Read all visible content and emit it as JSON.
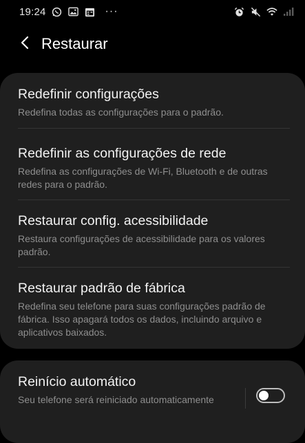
{
  "status_bar": {
    "time": "19:24",
    "left_icons": [
      "whatsapp-icon",
      "gallery-icon",
      "calendar-icon"
    ],
    "more": "···",
    "right_icons": [
      "alarm-icon",
      "mute-icon",
      "wifi-icon",
      "signal-icon"
    ]
  },
  "header": {
    "title": "Restaurar",
    "back_icon": "chevron-left-icon"
  },
  "reset_items": [
    {
      "title": "Redefinir configurações",
      "description": "Redefina todas as configurações para o padrão."
    },
    {
      "title": "Redefinir as configurações de rede",
      "description": "Redefina as configurações de Wi-Fi, Bluetooth e de outras redes para o padrão."
    },
    {
      "title": "Restaurar config. acessibilidade",
      "description": "Restaura configurações de acessibilidade para os valores padrão."
    },
    {
      "title": "Restaurar padrão de fábrica",
      "description": "Redefina seu telefone para suas configurações padrão de fábrica. Isso apagará todos os dados, incluindo arquivo e aplicativos baixados."
    }
  ],
  "auto_restart": {
    "title": "Reinício automático",
    "description": "Seu telefone será reiniciado automaticamente",
    "enabled": false
  },
  "colors": {
    "background": "#000000",
    "card": "#1f1f1f",
    "title_text": "#f2f2f2",
    "secondary_text": "#8e8e8e",
    "divider": "#353535"
  }
}
